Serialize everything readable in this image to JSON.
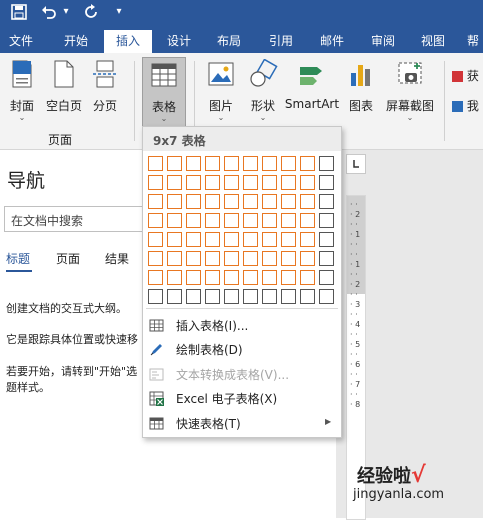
{
  "titlebar": {
    "save_icon": "save-icon",
    "undo_icon": "undo-icon",
    "redo_icon": "redo-icon",
    "dropdown_glyph": "▾",
    "more_glyph": "▾"
  },
  "tabs": [
    "文件",
    "开始",
    "插入",
    "设计",
    "布局",
    "引用",
    "邮件",
    "审阅",
    "视图",
    "帮"
  ],
  "active_tab": "插入",
  "ribbon": {
    "cover": "封面",
    "blank_page": "空白页",
    "page_break": "分页",
    "pages_group": "页面",
    "table": "表格",
    "pictures": "图片",
    "shapes": "形状",
    "smartart": "SmartArt",
    "chart": "图表",
    "screenshot": "屏幕截图",
    "get_addins": "获",
    "my_addins": "我",
    "dropdown": "⌄"
  },
  "nav": {
    "title": "导航",
    "search_placeholder": "在文档中搜索",
    "tabs": [
      "标题",
      "页面",
      "结果"
    ],
    "line1": "创建文档的交互式大纲。",
    "line2": "它是跟踪具体位置或快速移",
    "line3a": "若要开始，请转到\"开始\"选",
    "line3b": "题样式。"
  },
  "table_menu": {
    "header": "9x7 表格",
    "grid_cols": 10,
    "grid_rows": 8,
    "selected_cols": 9,
    "selected_rows": 7,
    "accent_color": "#e87722",
    "items": [
      {
        "label": "插入表格(I)...",
        "icon": "insert-table-icon",
        "disabled": false
      },
      {
        "label": "绘制表格(D)",
        "icon": "draw-table-icon",
        "disabled": false
      },
      {
        "label": "文本转换成表格(V)...",
        "icon": "convert-text-icon",
        "disabled": true
      },
      {
        "label": "Excel 电子表格(X)",
        "icon": "excel-icon",
        "disabled": false
      },
      {
        "label": "快速表格(T)",
        "icon": "quick-table-icon",
        "disabled": false
      }
    ],
    "submenu_arrow": "▶"
  },
  "ruler_ticks": "· · · 2 · · · 1 · · · · · 1 · · · 2 · · · 3 · · · 4 · · · 5 · · · 6 · · · 7 · · · 8",
  "watermark": {
    "line1": "经验啦",
    "check": "√",
    "line2": "jingyanla.com"
  },
  "colors": {
    "brand": "#2b579a",
    "check": "#e53935"
  }
}
